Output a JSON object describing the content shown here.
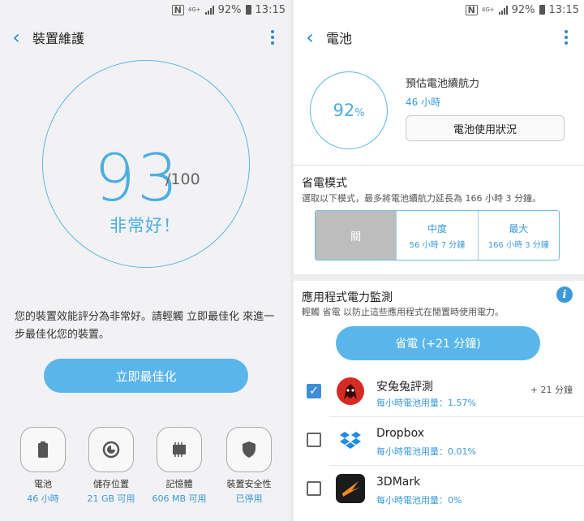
{
  "status_bar": {
    "battery": "92%",
    "time": "13:15",
    "network": "4G+"
  },
  "left": {
    "title": "裝置維護",
    "score": "93",
    "score_max": "/100",
    "score_label": "非常好！",
    "description": "您的裝置效能評分為非常好。請輕觸 立即最佳化 來進一步最佳化您的裝置。",
    "optimize_button": "立即最佳化",
    "tiles": [
      {
        "label": "電池",
        "value": "46 小時",
        "icon": "battery-icon"
      },
      {
        "label": "儲存位置",
        "value": "21 GB 可用",
        "icon": "storage-icon"
      },
      {
        "label": "記憶體",
        "value": "606 MB 可用",
        "icon": "memory-icon"
      },
      {
        "label": "裝置安全性",
        "value": "已停用",
        "icon": "shield-icon"
      }
    ]
  },
  "right": {
    "title": "電池",
    "battery_percent": "92",
    "battery_unit": "%",
    "estimate_label": "預估電池續航力",
    "estimate_value": "46 小時",
    "usage_button": "電池使用狀況",
    "power_saving": {
      "title": "省電模式",
      "subtitle": "選取以下模式，最多將電池續航力延長為 166 小時 3 分鐘。",
      "modes": [
        {
          "name": "關",
          "time": "",
          "selected": true
        },
        {
          "name": "中度",
          "time": "56 小時 7 分鐘",
          "selected": false
        },
        {
          "name": "最大",
          "time": "166 小時 3 分鐘",
          "selected": false
        }
      ]
    },
    "monitor": {
      "title": "應用程式電力監測",
      "subtitle": "輕觸 省電 以防止這些應用程式在閒置時使用電力。",
      "save_button": "省電 (+21 分鐘)",
      "apps": [
        {
          "name": "安兔兔評測",
          "usage": "每小時電池用量：1.57%",
          "gain": "+ 21 分鐘",
          "checked": true,
          "icon": "antutu-icon"
        },
        {
          "name": "Dropbox",
          "usage": "每小時電池用量：0.01%",
          "gain": "",
          "checked": false,
          "icon": "dropbox-icon"
        },
        {
          "name": "3DMark",
          "usage": "每小時電池用量：0%",
          "gain": "",
          "checked": false,
          "icon": "3dmark-icon"
        }
      ]
    }
  },
  "colors": {
    "accent": "#4baee3",
    "button": "#5ab6ea",
    "link": "#3a9ad9"
  }
}
